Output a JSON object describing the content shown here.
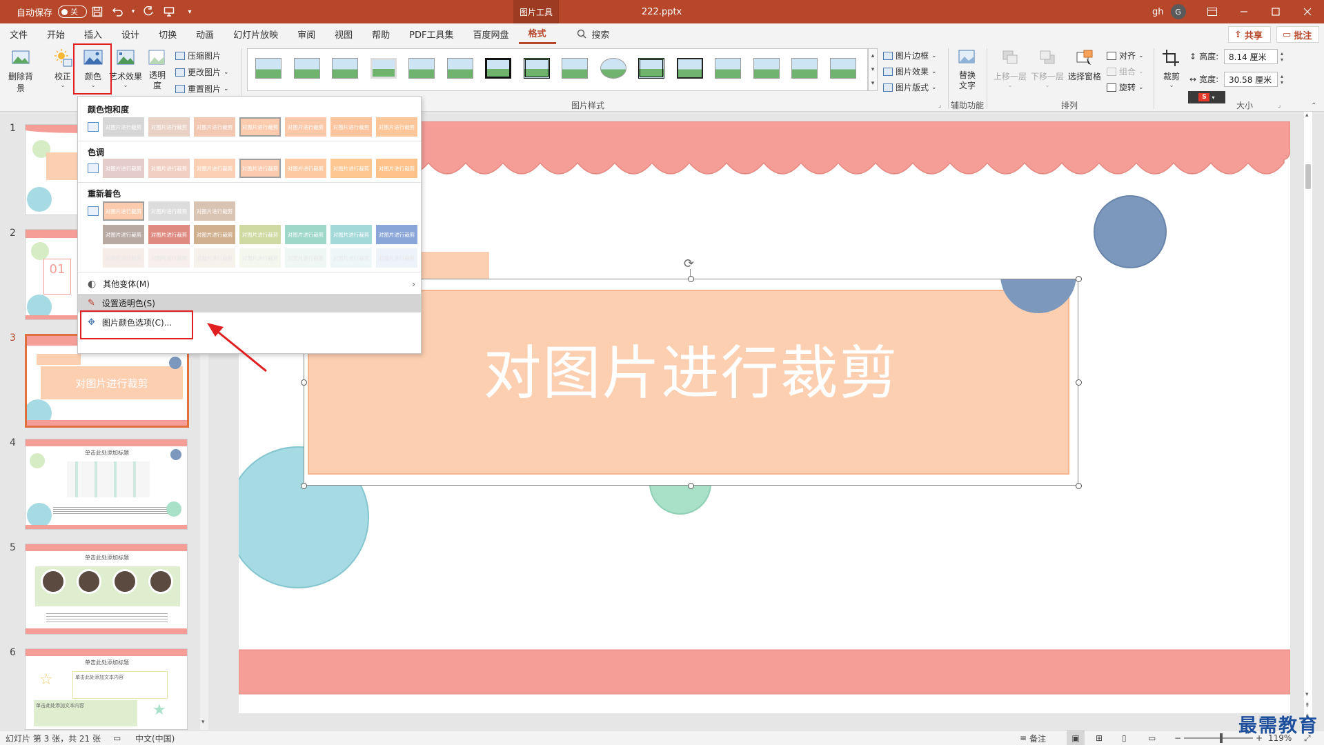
{
  "titlebar": {
    "autosave_label": "自动保存",
    "autosave_state": "关",
    "picture_tools": "图片工具",
    "file_name": "222.pptx",
    "user_initials": "gh",
    "avatar_letter": "G"
  },
  "tabs": [
    "文件",
    "开始",
    "插入",
    "设计",
    "切换",
    "动画",
    "幻灯片放映",
    "审阅",
    "视图",
    "帮助",
    "PDF工具集",
    "百度网盘",
    "格式"
  ],
  "active_tab": "格式",
  "search_label": "搜索",
  "share_label": "共享",
  "comment_label": "批注",
  "ribbon": {
    "remove_bg": "删除背景",
    "correct": "校正",
    "color": "颜色",
    "artistic": "艺术效果",
    "transparency_line1": "透明",
    "transparency_line2": "度",
    "compress": "压缩图片",
    "change": "更改图片",
    "reset": "重置图片",
    "picture_border": "图片边框",
    "picture_effects": "图片效果",
    "picture_layout": "图片版式",
    "styles_group": "图片样式",
    "alt_text_line1": "替换",
    "alt_text_line2": "文字",
    "accessibility_group": "辅助功能",
    "bring_forward": "上移一层",
    "send_backward": "下移一层",
    "selection_pane": "选择窗格",
    "align": "对齐",
    "group": "组合",
    "rotate": "旋转",
    "arrange_group": "排列",
    "crop": "裁剪",
    "height_label": "高度:",
    "height_value": "8.14 厘米",
    "width_label": "宽度:",
    "width_value": "30.58 厘米",
    "size_group": "大小"
  },
  "dropdown": {
    "saturation_title": "颜色饱和度",
    "tone_title": "色调",
    "recolor_title": "重新着色",
    "swatch_text": "对图片进行裁剪",
    "more_variations": "其他变体(M)",
    "set_transparent": "设置透明色(S)",
    "color_options": "图片颜色选项(C)...",
    "saturation_colors": [
      "#d6d6d6",
      "#ead1c6",
      "#f3c8b2",
      "#fccbae",
      "#fcc8a8",
      "#fdc39c",
      "#fec598"
    ],
    "tone_colors": [
      "#e4cccb",
      "#f2cfc3",
      "#fbd0b5",
      "#fccbae",
      "#fdc9a3",
      "#fec690",
      "#ffc28a"
    ],
    "recolor_row1": [
      "#fccbae",
      "#dcdcdc",
      "#d9c3b3"
    ],
    "recolor_row2": [
      "#b8aaa3",
      "#df8a80",
      "#d1b090",
      "#cfd9a2",
      "#9ed8c9",
      "#a4d9d9",
      "#8aa6d8"
    ],
    "recolor_row3": [
      "#f7ede8",
      "#f7eeee",
      "#f7f1ec",
      "#f4f7ee",
      "#eef7f4",
      "#eef7f7",
      "#eef2f9"
    ]
  },
  "slides": {
    "numbers": [
      "1",
      "2",
      "3",
      "4",
      "5",
      "6"
    ],
    "active": "3",
    "thumb2_number": "01",
    "thumb3_title": "对图片进行裁剪",
    "thumb_title_placeholder": "单击此处添加标题",
    "thumb6_text1": "单击此处添加文本内容",
    "thumb6_text2": "单击此处添加文本内容"
  },
  "main_slide": {
    "title": "对图片进行裁剪"
  },
  "statusbar": {
    "slide_info": "幻灯片 第 3 张，共 21 张",
    "language": "中文(中国)",
    "notes": "备注",
    "zoom": "119%"
  },
  "watermark": "最需教育",
  "colors": {
    "brand": "#b7472a",
    "salmon": "#f59e98",
    "peach": "#fdcfb1",
    "blue_circle": "#7c98bd",
    "teal_circle": "#a6dbe3",
    "mint_circle": "#a8e0c8",
    "highlight_red": "#e02020"
  }
}
